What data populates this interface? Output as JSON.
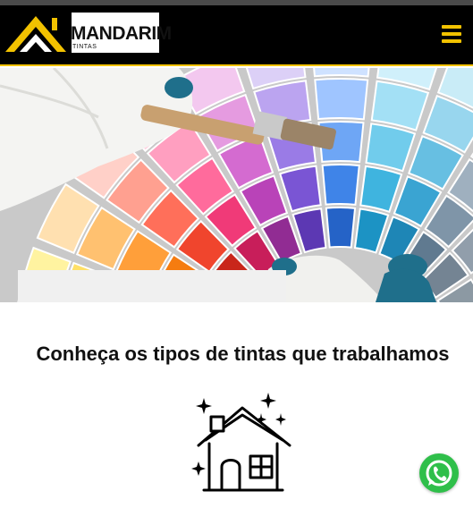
{
  "header": {
    "logo_name": "MANDARIM",
    "logo_sub": "TINTAS",
    "menu_icon": "hamburger-menu-icon",
    "accent_color": "#f2c200"
  },
  "hero": {
    "image": "paint-color-fan-swatches-with-brush"
  },
  "main": {
    "section_title": "Conheça os tipos de tintas que trabalhamos",
    "feature_icon": "house-sparkle-icon"
  },
  "floating": {
    "whatsapp_icon": "whatsapp-icon",
    "whatsapp_color": "#2fbf4a"
  }
}
